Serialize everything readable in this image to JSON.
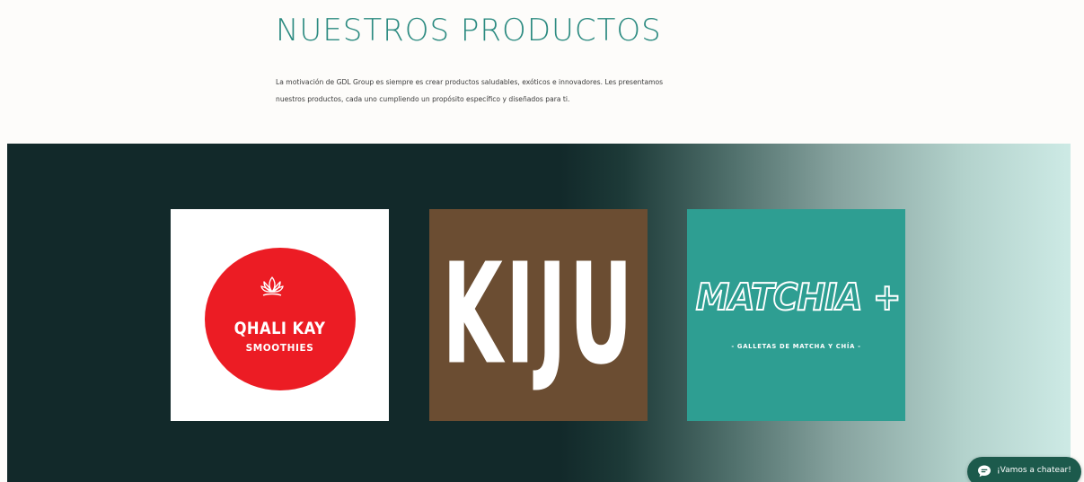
{
  "section": {
    "heading": "NUESTROS PRODUCTOS",
    "intro_line1": "La motivación de GDL Group es siempre es crear productos saludables, exóticos e innovadores. Les presentamos",
    "intro_line2": "nuestros productos, cada uno cumpliendo un propósito específico y diseñados para ti."
  },
  "products": [
    {
      "name": "QHALI KAY",
      "subtitle": "SMOOTHIES",
      "background": "#ffffff",
      "accent": "#ec1c24",
      "icon": "lotus-icon"
    },
    {
      "name": "KIJU",
      "background": "#6b4d32",
      "accent": "#ffffff"
    },
    {
      "name": "MATCHIA +",
      "subtitle": "- GALLETAS DE MATCHA Y CHÍA -",
      "background": "#2e9e92",
      "accent": "#ffffff"
    }
  ],
  "colors": {
    "heading": "#2b8a80",
    "band_dark": "#12292a",
    "band_light": "#cdeae5",
    "chat_button": "#1c5a4c"
  },
  "chat": {
    "label": "¡Vamos a chatear!",
    "icon": "chat-bubble-icon"
  }
}
